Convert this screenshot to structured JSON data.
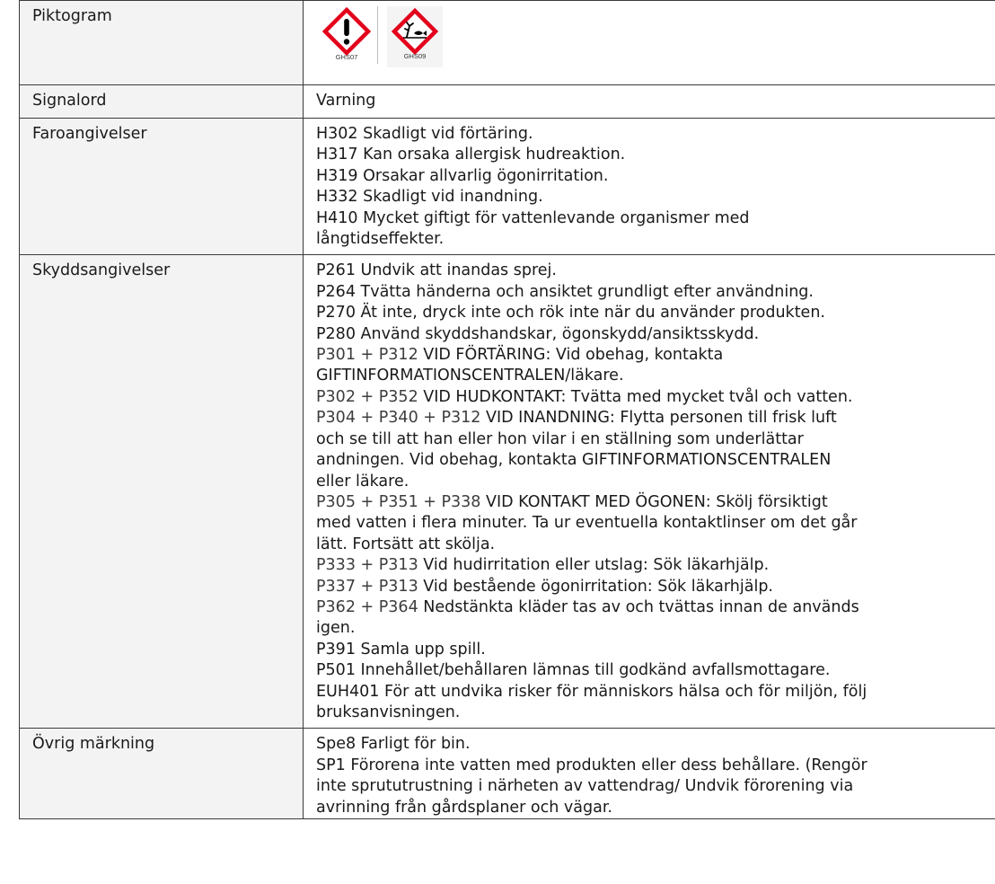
{
  "rows": {
    "piktogram": {
      "label": "Piktogram",
      "pictograms": [
        {
          "code": "GHS07",
          "icon": "exclamation-mark-icon"
        },
        {
          "code": "GHS09",
          "icon": "environment-hazard-icon"
        }
      ]
    },
    "signalord": {
      "label": "Signalord",
      "value": "Varning"
    },
    "faroangivelser": {
      "label": "Faroangivelser",
      "lines": [
        "H302 Skadligt vid förtäring.",
        "H317 Kan orsaka allergisk hudreaktion.",
        "H319 Orsakar allvarlig ögonirritation.",
        "H332 Skadligt vid inandning.",
        "H410 Mycket giftigt för vattenlevande organismer med",
        "långtidseffekter."
      ]
    },
    "skyddsangivelser": {
      "label": "Skyddsangivelser",
      "lines": [
        {
          "code": "",
          "text": "P261 Undvik att inandas sprej."
        },
        {
          "code": "",
          "text": "P264 Tvätta händerna och ansiktet grundligt efter användning."
        },
        {
          "code": "",
          "text": "P270 Ät inte, dryck inte och rök inte när du använder produkten."
        },
        {
          "code": "",
          "text": "P280 Använd skyddshandskar, ögonskydd/ansiktsskydd."
        },
        {
          "code": "P301 + P312",
          "text": " VID FÖRTÄRING: Vid obehag, kontakta"
        },
        {
          "code": "",
          "text": "GIFTINFORMATIONSCENTRALEN/läkare."
        },
        {
          "code": "P302 + P352",
          "text": " VID HUDKONTAKT: Tvätta med mycket tvål och vatten."
        },
        {
          "code": "P304 + P340 + P312",
          "text": " VID INANDNING: Flytta personen till frisk luft"
        },
        {
          "code": "",
          "text": "och se till att han eller hon vilar i en ställning som underlättar"
        },
        {
          "code": "",
          "text": "andningen. Vid obehag, kontakta GIFTINFORMATIONSCENTRALEN"
        },
        {
          "code": "",
          "text": "eller läkare."
        },
        {
          "code": "P305 + P351 + P338",
          "text": " VID KONTAKT MED ÖGONEN: Skölj försiktigt"
        },
        {
          "code": "",
          "text": "med vatten i flera minuter. Ta ur eventuella kontaktlinser om det går"
        },
        {
          "code": "",
          "text": "lätt. Fortsätt att skölja."
        },
        {
          "code": "P333 + P313",
          "text": " Vid hudirritation eller utslag: Sök läkarhjälp."
        },
        {
          "code": "P337 + P313",
          "text": " Vid bestående ögonirritation: Sök läkarhjälp."
        },
        {
          "code": "P362 + P364",
          "text": " Nedstänkta kläder tas av och tvättas innan de används"
        },
        {
          "code": "",
          "text": "igen."
        },
        {
          "code": "",
          "text": "P391 Samla upp spill."
        },
        {
          "code": "",
          "text": "P501 Innehållet/behållaren lämnas till godkänd avfallsmottagare."
        },
        {
          "code": "",
          "text": "EUH401 För att undvika risker för människors hälsa och för miljön, följ"
        },
        {
          "code": "",
          "text": "bruksanvisningen."
        }
      ]
    },
    "ovrig": {
      "label": "Övrig märkning",
      "lines": [
        "Spe8 Farligt för bin.",
        "SP1 Förorena inte vatten med produkten eller dess behållare. (Rengör",
        "inte sprututrustning i närheten av vattendrag/ Undvik förorening via",
        "avrinning från gårdsplaner och vägar."
      ]
    }
  },
  "colors": {
    "diamond_border": "#e3001b",
    "label_background": "#f3f3f3",
    "grid_line": "#3a3a3a"
  }
}
